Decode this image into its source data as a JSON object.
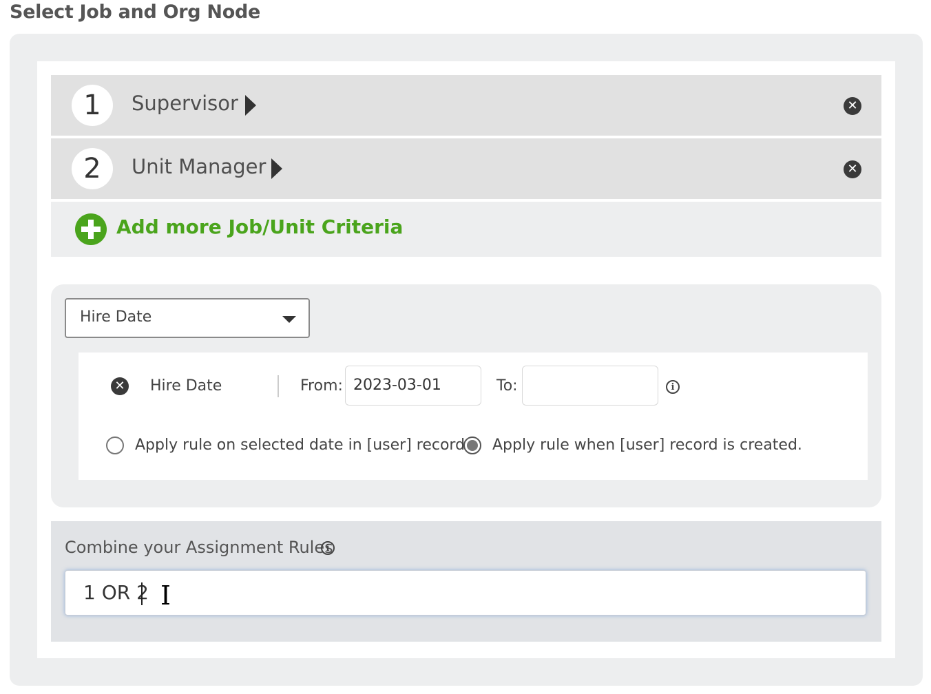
{
  "page": {
    "title": "Select Job and Org Node"
  },
  "criteria": [
    {
      "number": "1",
      "label": "Supervisor"
    },
    {
      "number": "2",
      "label": "Unit Manager"
    }
  ],
  "add_criteria": {
    "label": "Add more Job/Unit Criteria"
  },
  "date_filter": {
    "selected_option": "Hire Date",
    "filter_label": "Hire Date",
    "from_label": "From:",
    "from_value": "2023-03-01",
    "to_label": "To:",
    "to_value": "",
    "radio_options": [
      {
        "label": "Apply rule on selected date in [user] record.",
        "checked": false
      },
      {
        "label": "Apply rule when [user] record is created.",
        "checked": true
      }
    ]
  },
  "combine": {
    "title": "Combine your Assignment Rules",
    "value": "1 OR 2"
  },
  "icons": {
    "remove": "close-circle-icon",
    "add": "plus-circle-icon",
    "info": "info-icon",
    "expand": "triangle-right-icon",
    "dropdown": "chevron-down-icon"
  },
  "colors": {
    "accent_green": "#4aa41c",
    "panel_bg": "#edeeef",
    "row_bg": "#e1e1e1"
  }
}
